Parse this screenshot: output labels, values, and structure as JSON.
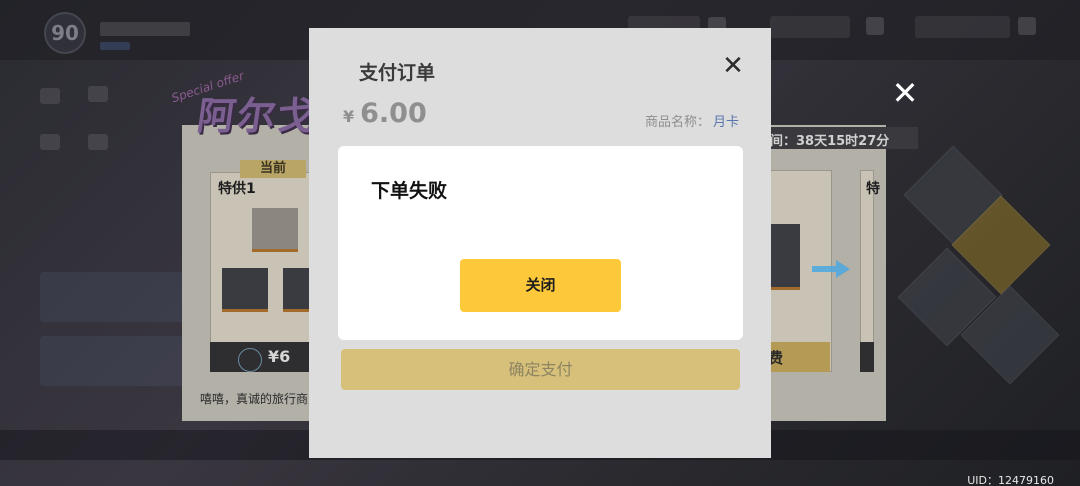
{
  "player": {
    "level": "90"
  },
  "event": {
    "title": "阿尔戈",
    "subtitle": "Special offer",
    "timer": "间：38天15时27分",
    "current_tag": "当前",
    "card1_label": "特供1",
    "card_next_label": "特",
    "price": "¥6",
    "right_price": "费",
    "merchant_text": "嘻嘻，真诚的旅行商人"
  },
  "payment": {
    "title": "支付订单",
    "currency": "¥",
    "amount": "6.00",
    "product_label": "商品名称：",
    "product_name": "月卡",
    "confirm_label": "确定支付"
  },
  "alert": {
    "message": "下单失败",
    "close_label": "关闭"
  },
  "uid": "UID：12479160",
  "colors": {
    "alert_button": "#fdc93a",
    "confirm_button": "#d6c07a",
    "dialog_bg": "#dddddd",
    "product_name": "#5a76b0"
  }
}
